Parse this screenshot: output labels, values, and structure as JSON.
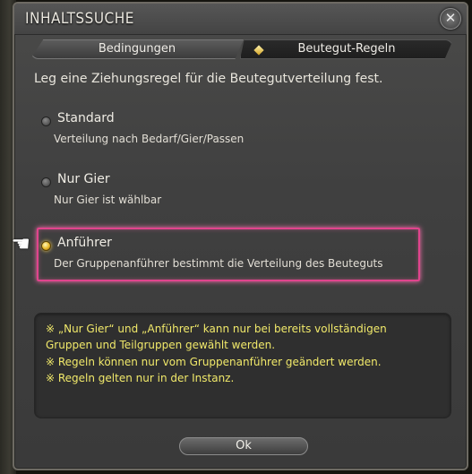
{
  "window": {
    "title": "INHALTSSUCHE",
    "close_icon": "close-icon"
  },
  "tabs": [
    {
      "label": "Bedingungen",
      "active": false
    },
    {
      "label": "Beutegut-Regeln",
      "active": true
    }
  ],
  "instruction": "Leg eine Ziehungsregel für die Beutegutverteilung fest.",
  "options": [
    {
      "label": "Standard",
      "description": "Verteilung nach Bedarf/Gier/Passen",
      "selected": false
    },
    {
      "label": "Nur Gier",
      "description": "Nur Gier ist wählbar",
      "selected": false
    },
    {
      "label": "Anführer",
      "description": "Der Gruppenanführer bestimmt die Verteilung des Beuteguts",
      "selected": true
    }
  ],
  "notes": [
    "※ „Nur Gier“ und „Anführer“ kann nur bei bereits vollständigen",
    "Gruppen und Teilgruppen gewählt werden.",
    "※ Regeln können nur vom Gruppenanführer geändert werden.",
    "※ Regeln gelten nur in der Instanz."
  ],
  "ok_label": "Ok",
  "colors": {
    "selection_border": "#e0448d",
    "note_text": "#f1e96a",
    "radio_on": "#e9b728"
  }
}
